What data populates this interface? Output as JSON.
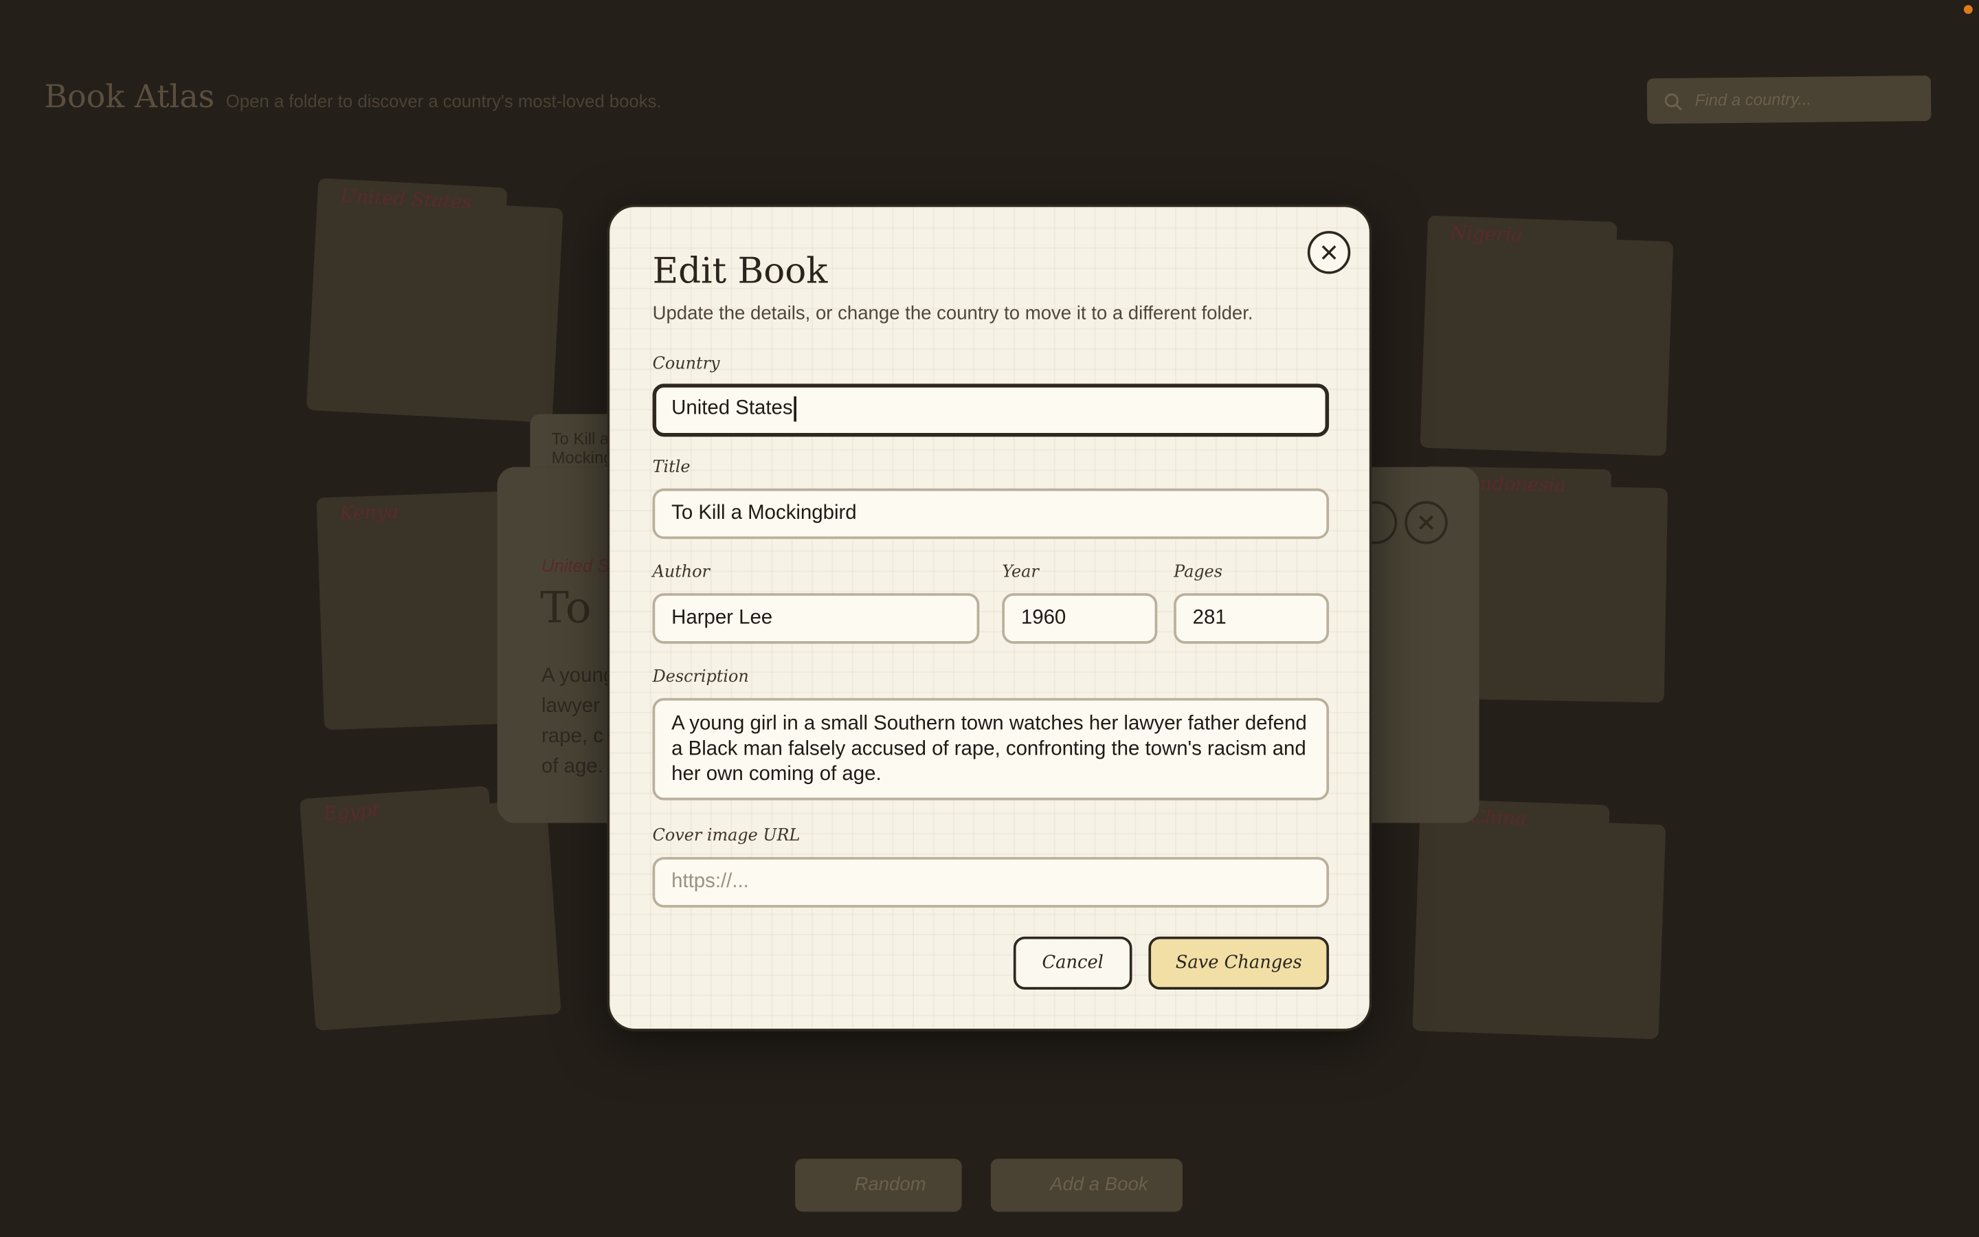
{
  "app": {
    "title": "Book Atlas",
    "subtitle": "Open a folder to discover a country's most-loved books.",
    "search_placeholder": "Find a country..."
  },
  "folders": [
    {
      "label": "United States"
    },
    {
      "label": "Nigeria"
    },
    {
      "label": "Kenya"
    },
    {
      "label": "Indonesia"
    },
    {
      "label": "Egypt"
    },
    {
      "label": "China"
    }
  ],
  "detail": {
    "tab_label": "To Kill a Mockingbird",
    "country": "United States",
    "title": "To Kill a Mockingbird",
    "text_lines": [
      "A young",
      "lawyer",
      "rape, c",
      "of age."
    ]
  },
  "bottom": {
    "random_label": "Random",
    "add_label": "Add a Book"
  },
  "modal": {
    "title": "Edit Book",
    "subtitle": "Update the details, or change the country to move it to a different folder.",
    "country_label": "Country",
    "country_value": "United States",
    "title_label": "Title",
    "title_value": "To Kill a Mockingbird",
    "author_label": "Author",
    "author_value": "Harper Lee",
    "year_label": "Year",
    "year_value": "1960",
    "pages_label": "Pages",
    "pages_value": "281",
    "description_label": "Description",
    "description_value": "A young girl in a small Southern town watches her lawyer father defend a Black man falsely accused of rape, confronting the town's racism and her own coming of age.",
    "cover_label": "Cover image URL",
    "cover_placeholder": "https://...",
    "cancel_label": "Cancel",
    "save_label": "Save Changes"
  }
}
